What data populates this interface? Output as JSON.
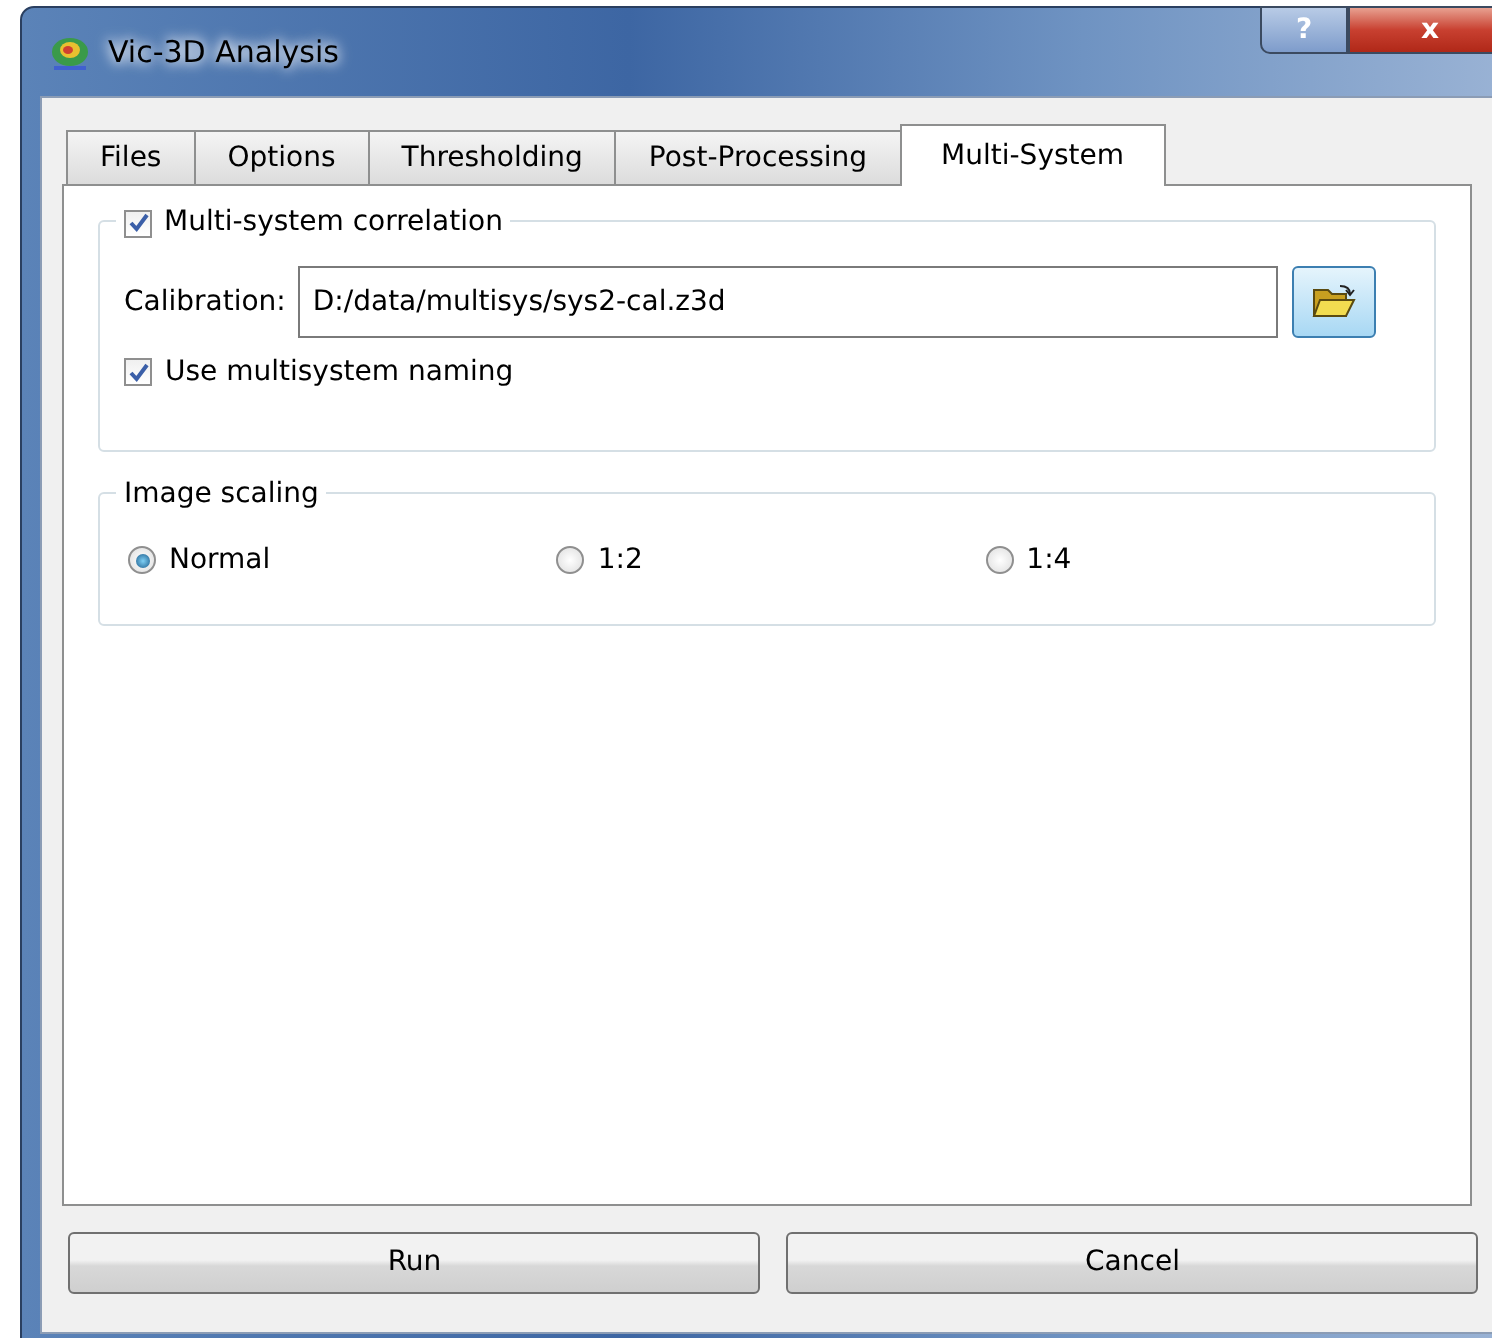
{
  "window": {
    "title": "Vic-3D Analysis",
    "help_button": "?",
    "close_button": "x"
  },
  "tabs": [
    {
      "label": "Files",
      "selected": false
    },
    {
      "label": "Options",
      "selected": false
    },
    {
      "label": "Thresholding",
      "selected": false
    },
    {
      "label": "Post-Processing",
      "selected": false
    },
    {
      "label": "Multi-System",
      "selected": true
    }
  ],
  "multi_system_group": {
    "label": "Multi-system correlation",
    "checked": true,
    "calibration_label": "Calibration:",
    "calibration_value": "D:/data/multisys/sys2-cal.z3d",
    "naming": {
      "label": "Use multisystem naming",
      "checked": true
    }
  },
  "image_scaling": {
    "title": "Image scaling",
    "options": [
      {
        "label": "Normal",
        "selected": true
      },
      {
        "label": "1:2",
        "selected": false
      },
      {
        "label": "1:4",
        "selected": false
      }
    ]
  },
  "buttons": [
    "Run",
    "Cancel"
  ]
}
